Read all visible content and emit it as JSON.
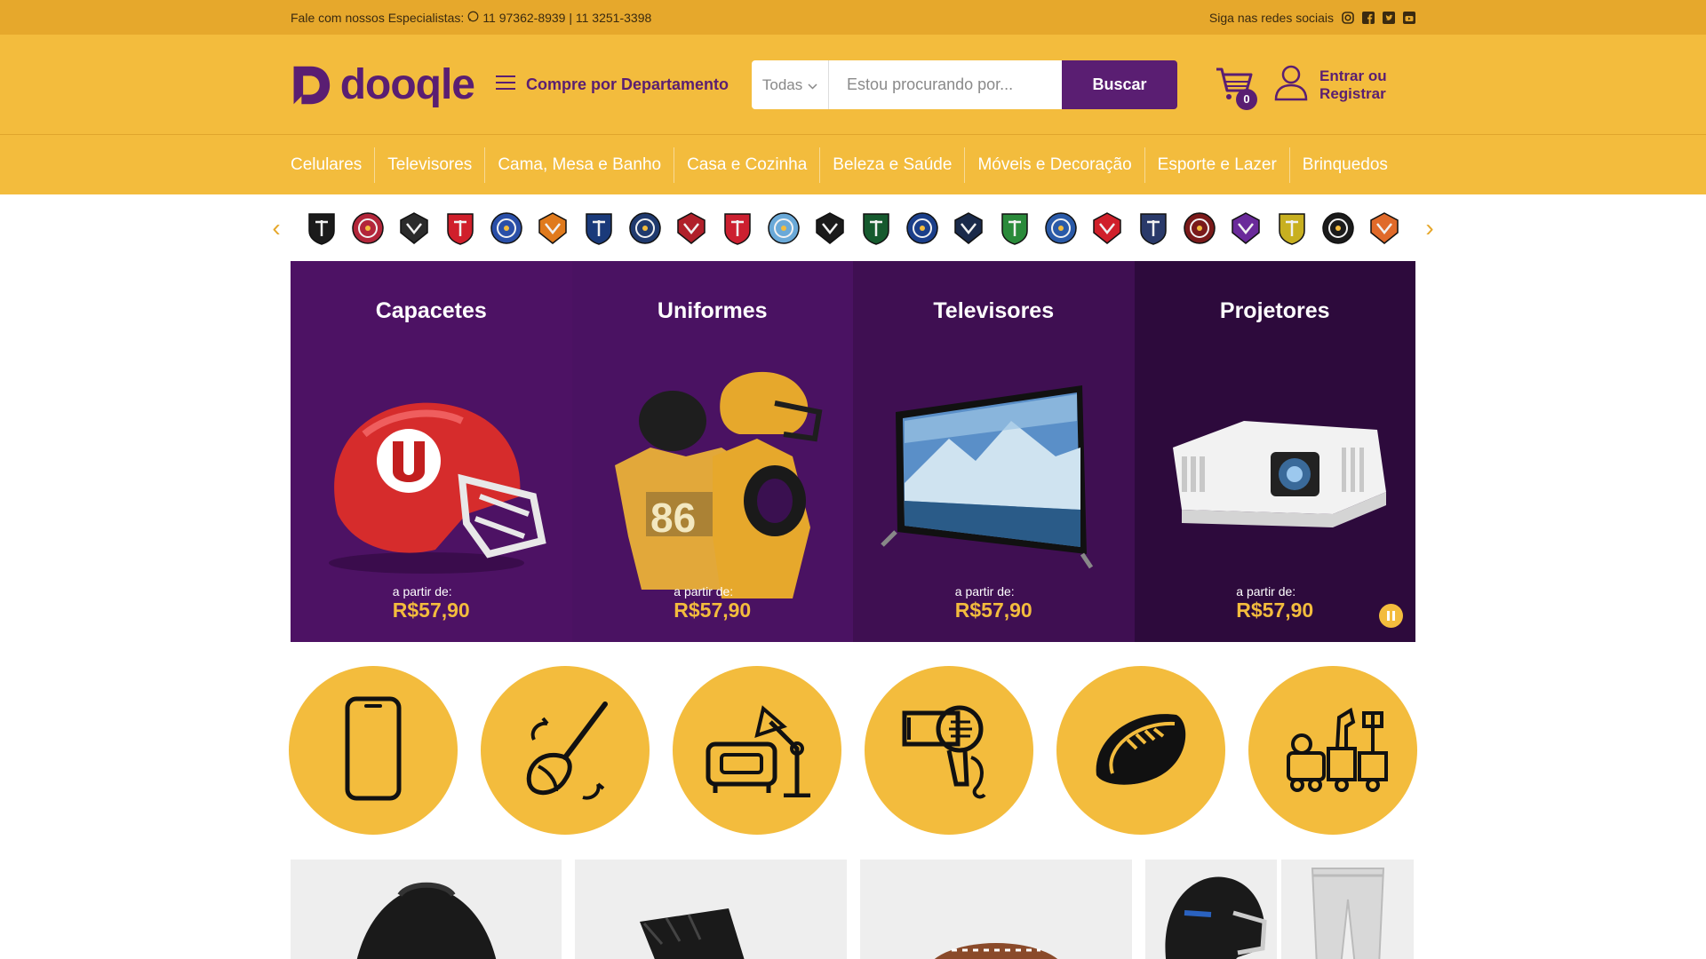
{
  "topbar": {
    "contact": "Fale com nossos Especialistas:",
    "phones": "11 97362-8939 | 11 3251-3398",
    "social_label": "Siga nas redes sociais",
    "icons": [
      "instagram-icon",
      "facebook-icon",
      "twitter-icon",
      "youtube-icon"
    ]
  },
  "header": {
    "logo_text": "dooqle",
    "department_label": "Compre por Departamento",
    "search": {
      "scope": "Todas",
      "placeholder": "Estou procurando por...",
      "button": "Buscar"
    },
    "cart_count": "0",
    "account_line1": "Entrar ou",
    "account_line2": "Registrar"
  },
  "categories": [
    "Celulares",
    "Televisores",
    "Cama, Mesa e Banho",
    "Casa e Cozinha",
    "Beleza e Saúde",
    "Móveis e Decoração",
    "Esporte e Lazer",
    "Brinquedos"
  ],
  "teams_count": 24,
  "banner": [
    {
      "title": "Capacetes",
      "from": "a partir de:",
      "price": "R$57,90"
    },
    {
      "title": "Uniformes",
      "from": "a partir de:",
      "price": "R$57,90"
    },
    {
      "title": "Televisores",
      "from": "a partir de:",
      "price": "R$57,90"
    },
    {
      "title": "Projetores",
      "from": "a partir de:",
      "price": "R$57,90"
    }
  ],
  "colors": {
    "brand_purple": "#5a1e72",
    "brand_yellow": "#f3bc3d",
    "top_strip": "#e6a82c"
  },
  "department_icons": [
    "smartphone-icon",
    "whisk-icon",
    "furniture-lamp-icon",
    "hair-dryer-icon",
    "football-icon",
    "toys-icon"
  ]
}
